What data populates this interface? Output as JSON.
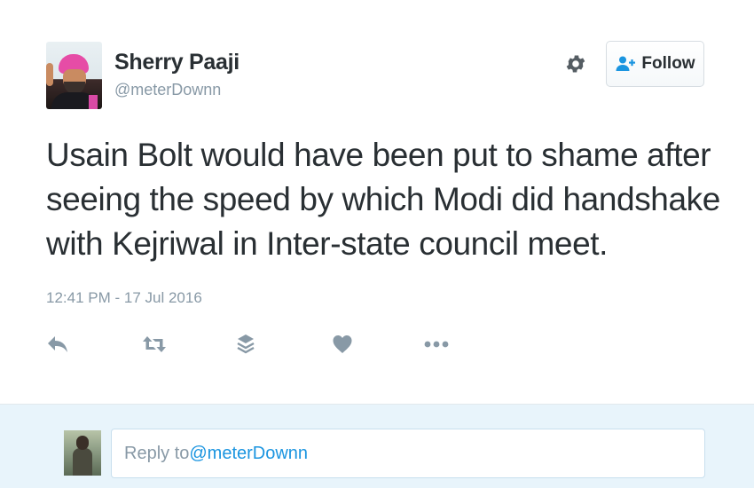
{
  "tweet": {
    "author_name": "Sherry Paaji",
    "author_handle": "@meterDownn",
    "follow_label": "Follow",
    "text_lines": [
      "Usain Bolt would have been put to shame after",
      "seeing the speed by which Modi did handshake",
      "with Kejriwal in Inter-state council meet."
    ],
    "timestamp": "12:41 PM - 17 Jul 2016",
    "actions": [
      "reply-icon",
      "retweet-icon",
      "stack-icon",
      "heart-icon",
      "more-icon"
    ]
  },
  "reply": {
    "prefix": "Reply to ",
    "mention": "@meterDownn"
  },
  "colors": {
    "text": "#292f33",
    "muted": "#8899a6",
    "link": "#1b95e0",
    "reply_bg": "#e8f4fb"
  }
}
